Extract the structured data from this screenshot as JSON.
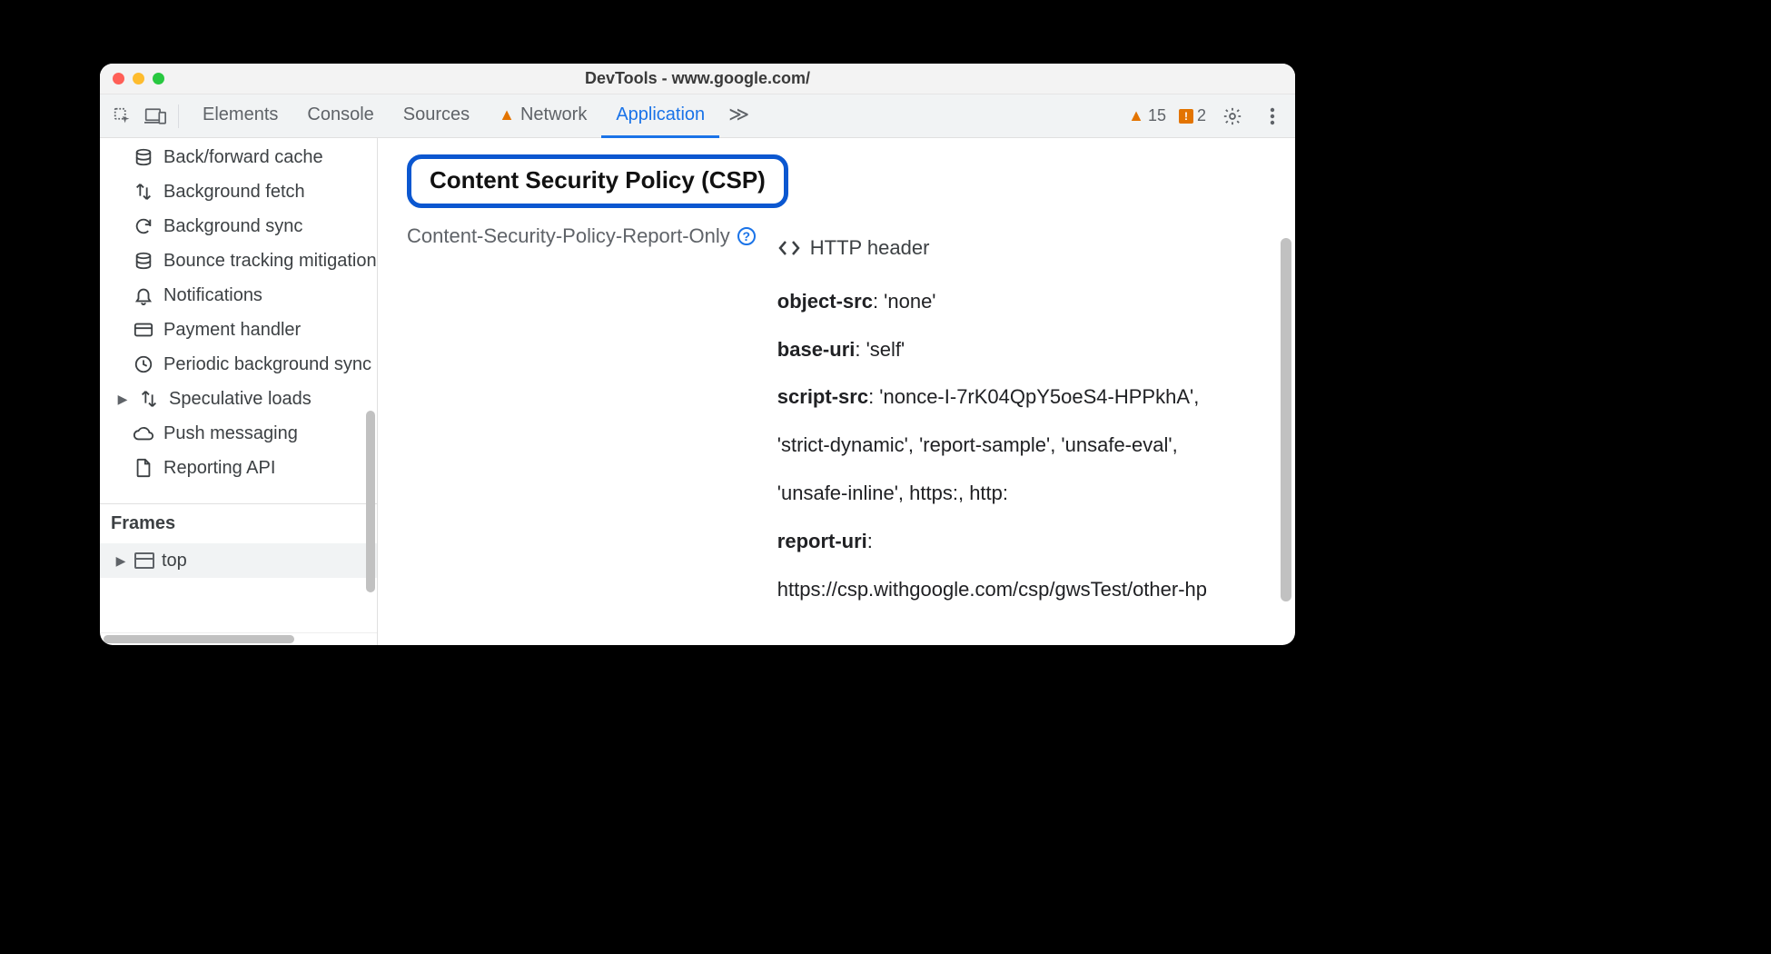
{
  "window": {
    "title": "DevTools - www.google.com/"
  },
  "toolbar": {
    "tabs": [
      {
        "label": "Elements",
        "active": false,
        "warn": false
      },
      {
        "label": "Console",
        "active": false,
        "warn": false
      },
      {
        "label": "Sources",
        "active": false,
        "warn": false
      },
      {
        "label": "Network",
        "active": false,
        "warn": true
      },
      {
        "label": "Application",
        "active": true,
        "warn": false
      }
    ],
    "more_glyph": "≫",
    "issues_count": "15",
    "messages_count": "2"
  },
  "sidebar": {
    "items": [
      {
        "icon": "database-icon",
        "label": "Back/forward cache",
        "arrow": false
      },
      {
        "icon": "updown-icon",
        "label": "Background fetch",
        "arrow": false
      },
      {
        "icon": "sync-icon",
        "label": "Background sync",
        "arrow": false
      },
      {
        "icon": "database-icon",
        "label": "Bounce tracking mitigation",
        "arrow": false
      },
      {
        "icon": "bell-icon",
        "label": "Notifications",
        "arrow": false
      },
      {
        "icon": "card-icon",
        "label": "Payment handler",
        "arrow": false
      },
      {
        "icon": "clock-icon",
        "label": "Periodic background sync",
        "arrow": false
      },
      {
        "icon": "updown-icon",
        "label": "Speculative loads",
        "arrow": true
      },
      {
        "icon": "cloud-icon",
        "label": "Push messaging",
        "arrow": false
      },
      {
        "icon": "file-icon",
        "label": "Reporting API",
        "arrow": false
      }
    ],
    "frames_header": "Frames",
    "frame_top": "top"
  },
  "csp": {
    "title": "Content Security Policy (CSP)",
    "header_name": "Content-Security-Policy-Report-Only",
    "source_label": "HTTP header",
    "directives": [
      {
        "name": "object-src",
        "value": ": 'none'"
      },
      {
        "name": "base-uri",
        "value": ": 'self'"
      },
      {
        "name": "script-src",
        "value": ": 'nonce-I-7rK04QpY5oeS4-HPPkhA',"
      },
      {
        "name": "",
        "value": "'strict-dynamic', 'report-sample', 'unsafe-eval',"
      },
      {
        "name": "",
        "value": "'unsafe-inline', https:, http:"
      },
      {
        "name": "report-uri",
        "value": ":"
      },
      {
        "name": "",
        "value": "https://csp.withgoogle.com/csp/gwsTest/other-hp"
      }
    ]
  }
}
